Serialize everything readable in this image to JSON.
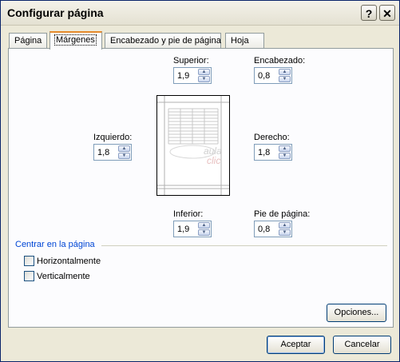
{
  "window": {
    "title": "Configurar página",
    "help_label": "?",
    "close_label": "✕"
  },
  "tabs": [
    {
      "label": "Página"
    },
    {
      "label": "Márgenes"
    },
    {
      "label": "Encabezado y pie de página"
    },
    {
      "label": "Hoja"
    }
  ],
  "margins": {
    "superior": {
      "label": "Superior:",
      "value": "1,9"
    },
    "encabezado": {
      "label": "Encabezado:",
      "value": "0,8"
    },
    "izquierdo": {
      "label": "Izquierdo:",
      "value": "1,8"
    },
    "derecho": {
      "label": "Derecho:",
      "value": "1,8"
    },
    "inferior": {
      "label": "Inferior:",
      "value": "1,9"
    },
    "pie": {
      "label": "Pie de página:",
      "value": "0,8"
    }
  },
  "center": {
    "group_label": "Centrar en la página",
    "horizontal": {
      "label": "Horizontalmente",
      "checked": false
    },
    "vertical": {
      "label": "Verticalmente",
      "checked": false
    }
  },
  "buttons": {
    "options": "Opciones...",
    "accept": "Aceptar",
    "cancel": "Cancelar"
  },
  "preview": {
    "watermark_top": "aula",
    "watermark_bottom": "clic"
  },
  "colors": {
    "active_tab_accent": "#e68b2c",
    "group_label": "#0046d5"
  }
}
